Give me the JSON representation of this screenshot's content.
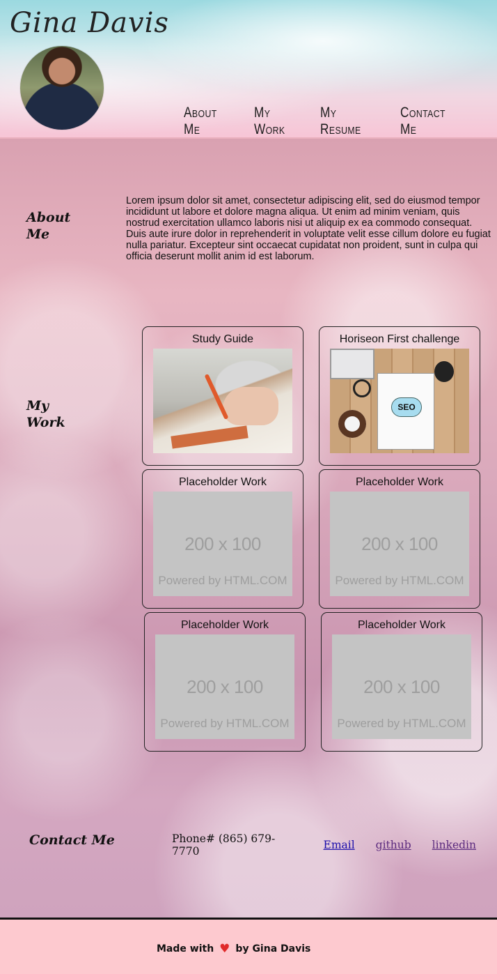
{
  "header": {
    "logo": "Gina Davis",
    "nav": [
      "About Me",
      "My Work",
      "My Resume",
      "Contact Me"
    ]
  },
  "about": {
    "title_line1": "About",
    "title_line2": "Me",
    "text": "Lorem ipsum dolor sit amet, consectetur adipiscing elit, sed do eiusmod tempor incididunt ut labore et dolore magna aliqua. Ut enim ad minim veniam, quis nostrud exercitation ullamco laboris nisi ut aliquip ex ea commodo consequat. Duis aute irure dolor in reprehenderit in voluptate velit esse cillum dolore eu fugiat nulla pariatur. Excepteur sint occaecat cupidatat non proident, sunt in culpa qui officia deserunt mollit anim id est laborum."
  },
  "work": {
    "title_line1": "My",
    "title_line2": "Work",
    "cards": [
      {
        "title": "Study Guide"
      },
      {
        "title": "Horiseon First challenge"
      },
      {
        "title": "Placeholder Work",
        "size": "200 x 100",
        "powered": "Powered by HTML.COM"
      },
      {
        "title": "Placeholder Work",
        "size": "200 x 100",
        "powered": "Powered by HTML.COM"
      },
      {
        "title": "Placeholder Work",
        "size": "200 x 100",
        "powered": "Powered by HTML.COM"
      },
      {
        "title": "Placeholder Work",
        "size": "200 x 100",
        "powered": "Powered by HTML.COM"
      }
    ],
    "seo_label": "SEO"
  },
  "contact": {
    "title": "Contact Me",
    "phone": "Phone# (865) 679-7770",
    "links": [
      "Email",
      "github",
      "linkedin"
    ]
  },
  "footer": {
    "made_with": "Made with",
    "heart": "♥",
    "by": "by Gina Davis"
  },
  "colors": {
    "link_unvisited": "#1a0dab",
    "link_visited": "#5b2a7e",
    "footer_bg": "#fdc9cf",
    "heart": "#e02a2a"
  }
}
